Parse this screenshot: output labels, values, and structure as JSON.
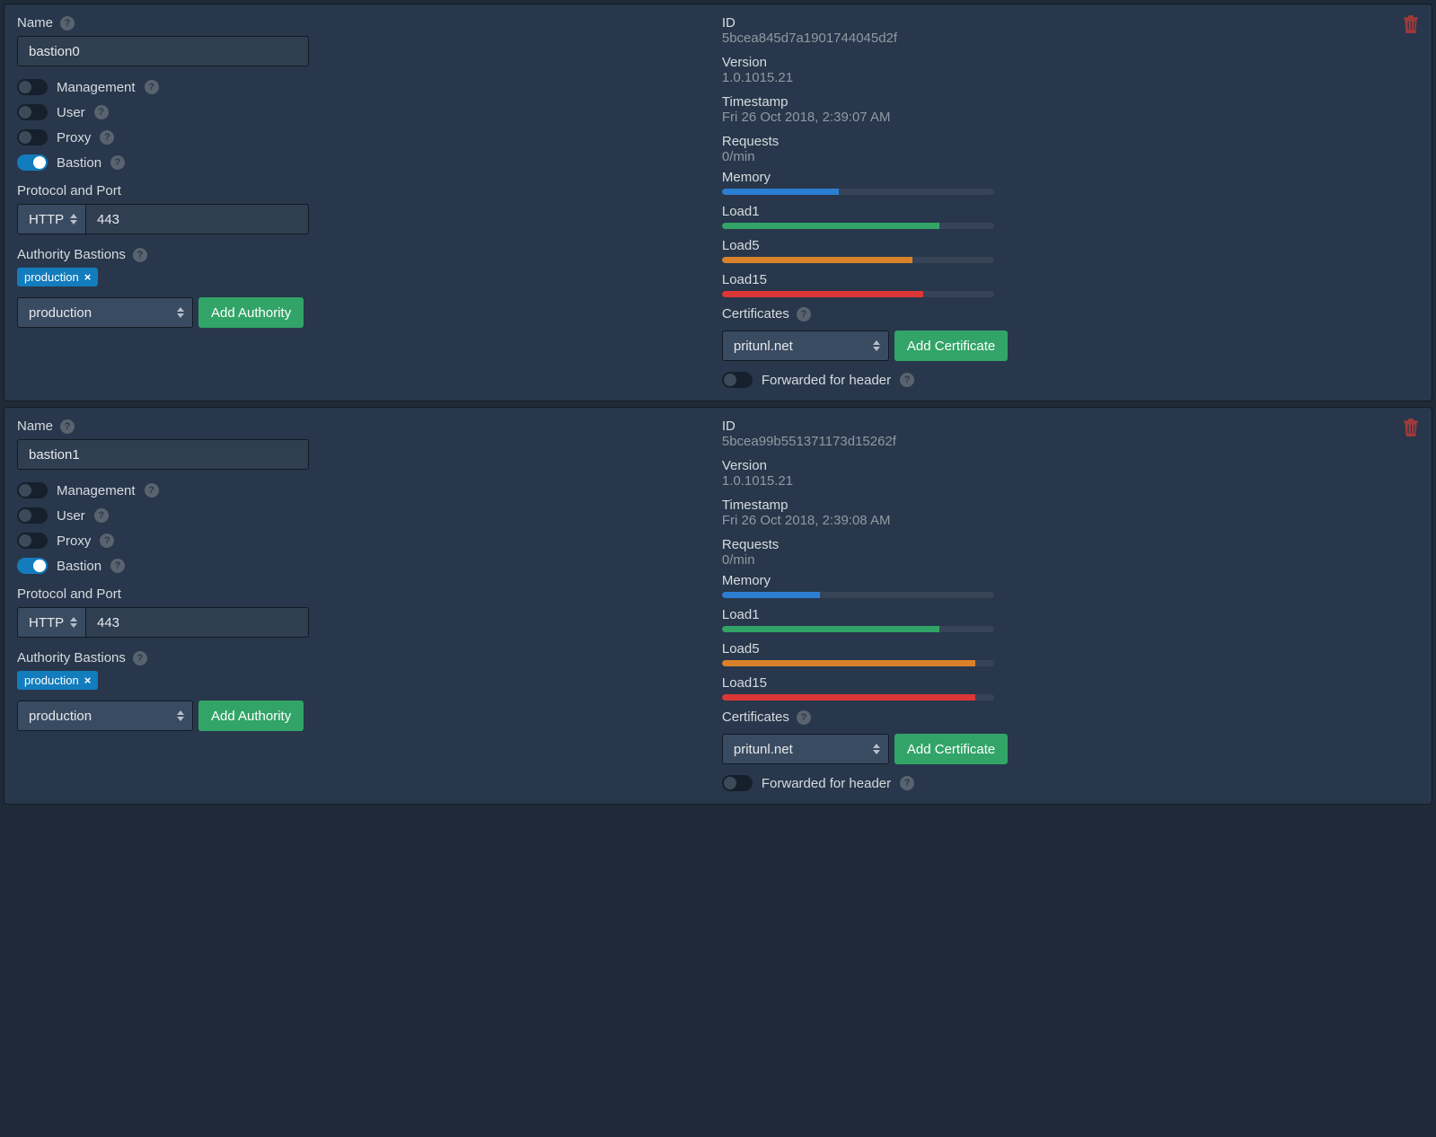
{
  "labels": {
    "name": "Name",
    "management": "Management",
    "user": "User",
    "proxy": "Proxy",
    "bastion": "Bastion",
    "protocolPort": "Protocol and Port",
    "authorityBastions": "Authority Bastions",
    "addAuthority": "Add Authority",
    "id": "ID",
    "version": "Version",
    "timestamp": "Timestamp",
    "requests": "Requests",
    "memory": "Memory",
    "load1": "Load1",
    "load5": "Load5",
    "load15": "Load15",
    "certificates": "Certificates",
    "addCertificate": "Add Certificate",
    "forwardedForHeader": "Forwarded for header"
  },
  "nodes": [
    {
      "name": "bastion0",
      "toggles": {
        "management": false,
        "user": false,
        "proxy": false,
        "bastion": true
      },
      "protocol": "HTTP",
      "port": "443",
      "bastionTag": "production",
      "authoritySelect": "production",
      "id": "5bcea845d7a1901744045d2f",
      "version": "1.0.1015.21",
      "timestamp": "Fri 26 Oct 2018, 2:39:07 AM",
      "requests": "0/min",
      "bars": {
        "memory": 43,
        "load1": 80,
        "load5": 70,
        "load15": 74
      },
      "certSelect": "pritunl.net",
      "forwarded": false
    },
    {
      "name": "bastion1",
      "toggles": {
        "management": false,
        "user": false,
        "proxy": false,
        "bastion": true
      },
      "protocol": "HTTP",
      "port": "443",
      "bastionTag": "production",
      "authoritySelect": "production",
      "id": "5bcea99b551371173d15262f",
      "version": "1.0.1015.21",
      "timestamp": "Fri 26 Oct 2018, 2:39:08 AM",
      "requests": "0/min",
      "bars": {
        "memory": 36,
        "load1": 80,
        "load5": 93,
        "load15": 93
      },
      "certSelect": "pritunl.net",
      "forwarded": false
    }
  ]
}
